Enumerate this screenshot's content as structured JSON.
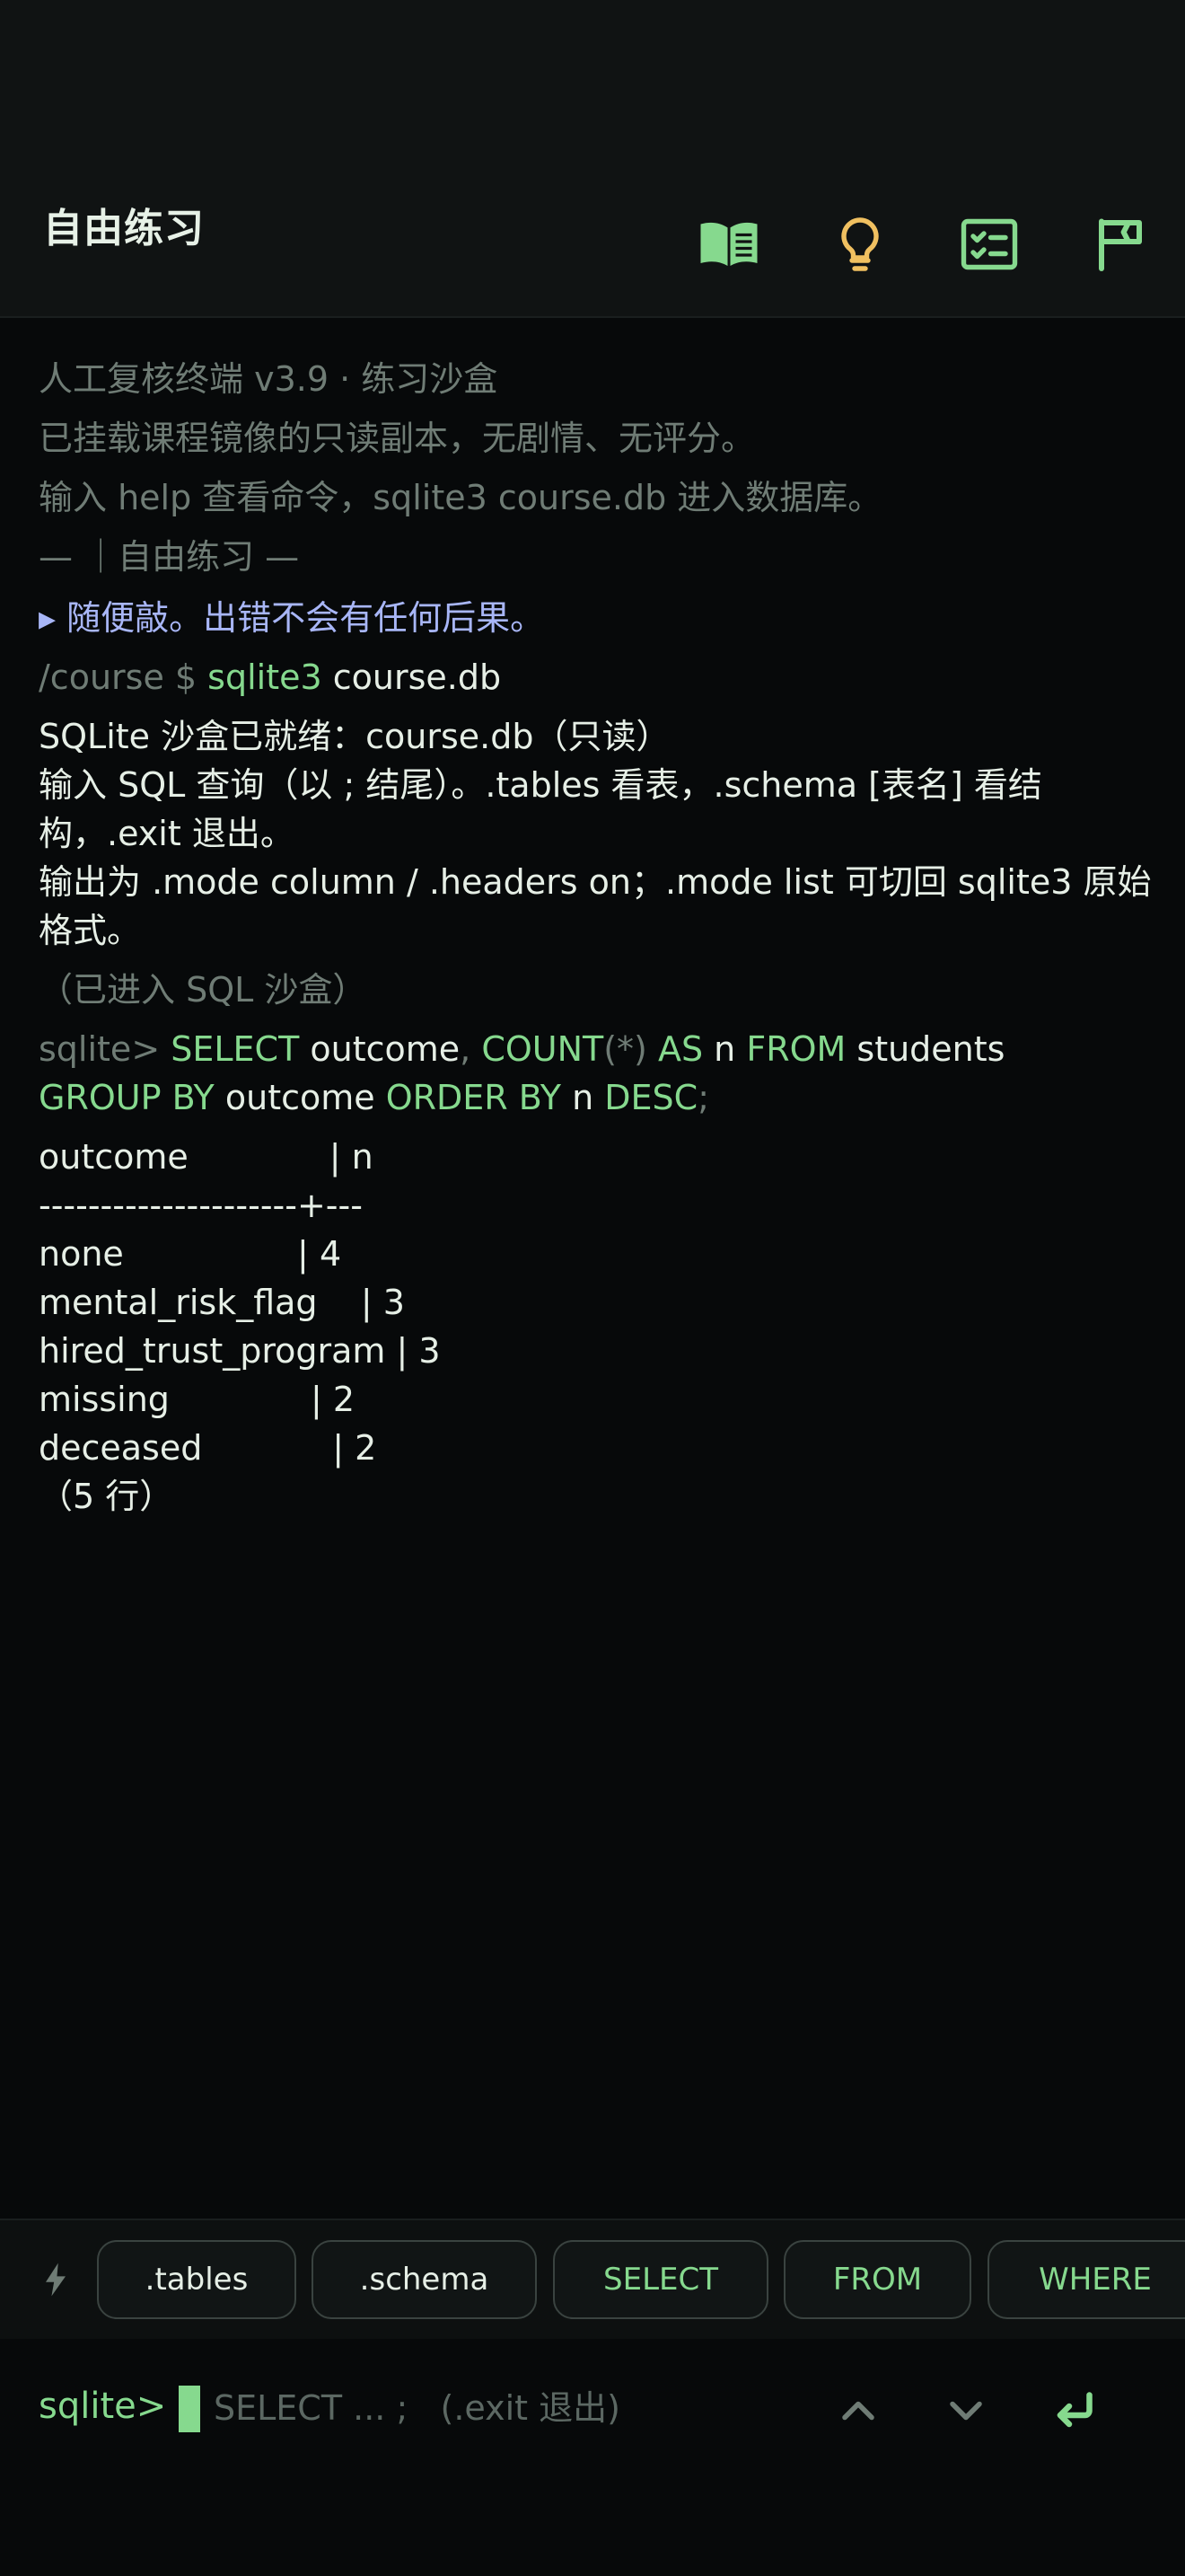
{
  "header": {
    "title": "自由练习"
  },
  "terminal": {
    "banner": [
      "人工复核终端 v3.9 · 练习沙盒",
      "已挂载课程镜像的只读副本，无剧情、无评分。",
      "输入 help 查看命令，sqlite3 course.db 进入数据库。",
      "— ｜自由练习 —"
    ],
    "hint": "▸ 随便敲。出错不会有任何后果。",
    "shell": {
      "prompt": "/course $ ",
      "cmd": "sqlite3",
      "arg": " course.db"
    },
    "ready": [
      "SQLite 沙盒已就绪：course.db（只读）",
      "输入 SQL 查询（以 ; 结尾）。.tables 看表，.schema [表名] 看结构，.exit 退出。",
      "输出为 .mode column / .headers on；.mode list 可切回 sqlite3 原始格式。"
    ],
    "entered": "（已进入 SQL 沙盒）",
    "query": {
      "prompt": "sqlite> ",
      "parts": [
        "SELECT",
        " outcome",
        ",",
        " COUNT",
        "(*)",
        " AS",
        " n",
        " FROM",
        " students",
        "GROUP BY",
        " outcome",
        " ORDER BY",
        " n",
        " DESC",
        ";"
      ]
    },
    "result": {
      "header": "outcome             | n",
      "separator": "---------------------+---",
      "rows": [
        "none                | 4",
        "mental_risk_flag    | 3",
        "hired_trust_program | 3",
        "missing             | 2",
        "deceased            | 2"
      ],
      "footer": "（5 行）"
    }
  },
  "quickkeys": [
    ".tables",
    ".schema",
    "SELECT",
    "FROM",
    "WHERE"
  ],
  "input": {
    "prompt": "sqlite>",
    "placeholder": "SELECT ... ;   (.exit 退出)"
  },
  "colors": {
    "accent": "#86d98e",
    "muted": "#6f7c75",
    "hint": "#a8b6f7",
    "lamp": "#f0c060",
    "background": "#07090a"
  },
  "icons": [
    "book-icon",
    "lightbulb-icon",
    "checklist-icon",
    "flag-icon",
    "bolt-icon",
    "chevron-up-icon",
    "chevron-down-icon",
    "enter-icon"
  ]
}
